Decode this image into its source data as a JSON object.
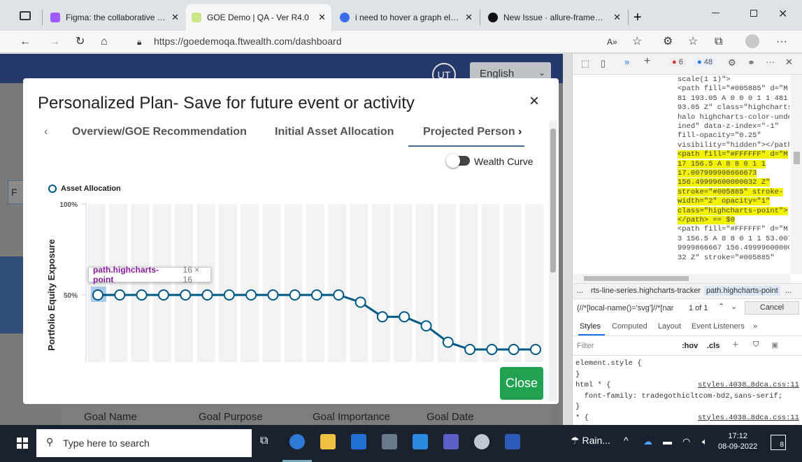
{
  "browser": {
    "tabs": [
      {
        "title": "Figma: the collaborative interface",
        "active": false
      },
      {
        "title": "GOE Demo | QA - Ver R4.0",
        "active": true
      },
      {
        "title": "i need to hover a graph element",
        "active": false
      },
      {
        "title": "New Issue · allure-framework/all",
        "active": false
      }
    ],
    "new_tab": "+",
    "url": "https://goedemoqa.ftwealth.com/dashboard",
    "aa": "A»"
  },
  "page": {
    "avatar": "UT",
    "language": "English",
    "left_letter": "F",
    "columns": [
      "Goal Name",
      "Goal Purpose",
      "Goal Importance",
      "Goal Date"
    ]
  },
  "modal": {
    "title": "Personalized Plan- Save for future event or activity",
    "close": "×",
    "tabs": [
      "Overview/GOE Recommendation",
      "Initial Asset Allocation",
      "Projected Person"
    ],
    "toggle_label": "Wealth Curve",
    "close_button": "Close",
    "tooltip": {
      "name": "path.highcharts-point",
      "size": "16 × 16"
    }
  },
  "chart_data": {
    "type": "line",
    "ylabel": "Portfolio Equity Exposure",
    "yticks": [
      "100%",
      "50%"
    ],
    "series": [
      {
        "name": "Asset Allocation",
        "values": [
          50,
          50,
          50,
          50,
          50,
          50,
          50,
          50,
          50,
          50,
          50,
          50,
          46,
          38,
          38,
          33,
          24,
          20,
          20,
          20,
          20
        ]
      }
    ],
    "color": "#005885"
  },
  "devtools": {
    "errors": "6",
    "messages": "48",
    "code": [
      {
        "t": "scale(1 1)\">",
        "hl": false
      },
      {
        "t": "<path fill=\"#005885\" d=\"M 4",
        "hl": false
      },
      {
        "t": "81 193.05 A 0 0 0 1 1 481 1",
        "hl": false
      },
      {
        "t": "93.05 Z\" class=\"highcharts-",
        "hl": false
      },
      {
        "t": "halo highcharts-color-undef",
        "hl": false
      },
      {
        "t": "ined\" data-z-index=\"-1\"",
        "hl": false
      },
      {
        "t": "fill-opacity=\"0.25\"",
        "hl": false
      },
      {
        "t": "visibility=\"hidden\"></path>",
        "hl": false
      },
      {
        "t": "<path fill=\"#FFFFFF\" d=\"M",
        "hl": true
      },
      {
        "t": "17 156.5 A 8 8 0 1 1",
        "hl": true
      },
      {
        "t": "17.007999998666673",
        "hl": true
      },
      {
        "t": "156.49999600000032 Z\"",
        "hl": true
      },
      {
        "t": "stroke=\"#005885\" stroke-",
        "hl": true
      },
      {
        "t": "width=\"2\" opacity=\"1\"",
        "hl": true
      },
      {
        "t": "class=\"highcharts-point\">",
        "hl": true
      },
      {
        "t": "</path> == $0",
        "hl": true
      },
      {
        "t": "<path fill=\"#FFFFFF\" d=\"M 5",
        "hl": false
      },
      {
        "t": "3 156.5 A 8 8 0 1 1 53.0079",
        "hl": false
      },
      {
        "t": "9999866667 156.4999960000000",
        "hl": false
      },
      {
        "t": "32 Z\" stroke=\"#005885\"",
        "hl": false
      }
    ],
    "crumbs": [
      "...",
      "rts-line-series.highcharts-tracker",
      "path.highcharts-point",
      "..."
    ],
    "search_value": "(//*[local-name()='svg']//*[nar",
    "search_count": "1 of 1",
    "cancel": "Cancel",
    "subtabs": [
      "Styles",
      "Computed",
      "Layout",
      "Event Listeners",
      "»"
    ],
    "filter": "Filter",
    "hov": ":hov",
    "cls": ".cls",
    "styles": [
      {
        "sel": "element.style {",
        "src": ""
      },
      {
        "sel": "}",
        "src": ""
      },
      {
        "sel": "html * {",
        "src": "styles.4038…8dca.css:11"
      },
      {
        "sel": "  font-family: tradegothicltcom-bd2,sans-serif;",
        "src": ""
      },
      {
        "sel": "}",
        "src": ""
      },
      {
        "sel": "* {",
        "src": "styles.4038…8dca.css:11"
      }
    ]
  },
  "taskbar": {
    "search": "Type here to search",
    "weather": "Rain...",
    "time": "17:12",
    "date": "08-09-2022",
    "badge": "8"
  }
}
